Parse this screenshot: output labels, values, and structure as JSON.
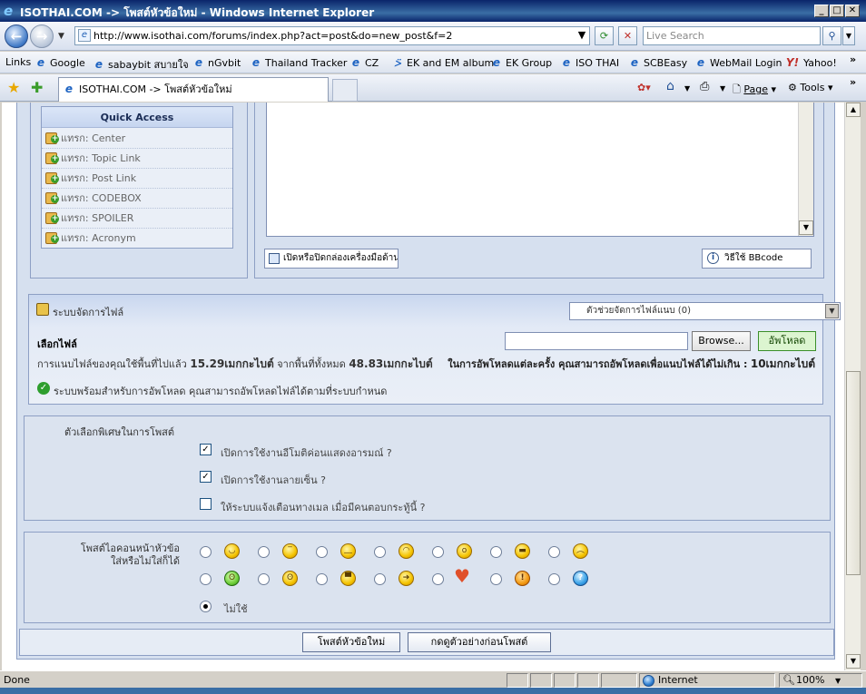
{
  "window": {
    "title": "ISOTHAI.COM -> โพสต์หัวข้อใหม่ - Windows Internet Explorer"
  },
  "address_bar": {
    "url": "http://www.isothai.com/forums/index.php?act=post&do=new_post&f=2",
    "search_placeholder": "Live Search"
  },
  "links_bar": {
    "label": "Links",
    "items": [
      "Google",
      "sabaybit สบายใจ",
      "nGvbit",
      "Thailand Tracker",
      "CZ",
      "EK and EM album",
      "EK Group",
      "ISO THAI",
      "SCBEasy",
      "WebMail Login",
      "Yahoo!"
    ]
  },
  "tab_bar": {
    "active_tab": "ISOTHAI.COM -> โพสต์หัวข้อใหม่",
    "page_menu": "Page",
    "tools_menu": "Tools"
  },
  "quick_access": {
    "title": "Quick Access",
    "items": [
      "แทรก: Center",
      "แทรก: Topic Link",
      "แทรก: Post Link",
      "แทรก: CODEBOX",
      "แทรก: SPOILER",
      "แทรก: Acronym"
    ]
  },
  "editor": {
    "toggle_toolbar_label": "เปิดหรือปิดกล่องเครื่องมือด้านข",
    "bbcode_help_label": "วิธีใช้ BBcode"
  },
  "file_manager": {
    "title": "ระบบจัดการไฟล์",
    "attach_helper_select": "ตัวช่วยจัดการไฟล์แนบ (0)",
    "choose_file_label": "เลือกไฟล์",
    "browse_label": "Browse...",
    "upload_label": "อัพโหลด",
    "usage_prefix": "การแนบไฟล์ของคุณใช้พื้นที่ไปแล้ว",
    "used_space": "15.29เมกกะไบต์",
    "usage_middle": "จากพื้นที่ทั้งหมด",
    "total_space": "48.83เมกกะไบต์",
    "limit_prefix": "ในการอัพโหลดแต่ละครั้ง คุณสามารถอัพโหลดเพื่อแนบไฟล์ได้ไม่เกิน :",
    "limit_value": "10เมกกะไบต์",
    "ready_message": "ระบบพร้อมสำหรับการอัพโหลด คุณสามารถอัพโหลดไฟล์ได้ตามที่ระบบกำหนด"
  },
  "post_options": {
    "title": "ตัวเลือกพิเศษในการโพสต์",
    "options": [
      {
        "label": "เปิดการใช้งานอีโมติค่อนแสดงอารมณ์ ?",
        "checked": true
      },
      {
        "label": "เปิดการใช้งานลายเซ็น ?",
        "checked": true
      },
      {
        "label": "ให้ระบบแจ้งเตือนทางเมล เมื่อมีคนตอบกระทู้นี้ ?",
        "checked": false
      }
    ]
  },
  "post_icons": {
    "title_line1": "โพสต์ไอคอนหน้าหัวข้อ",
    "title_line2": "ใส่หรือไม่ใส่ก็ได้",
    "none_label": "ไม่ใช้",
    "icons_row1": [
      "smile-icon",
      "neutral-icon",
      "sleepy-icon",
      "wink-icon",
      "surprised-icon",
      "grin-icon",
      "angry-icon"
    ],
    "icons_row2": [
      "sick-icon",
      "confused-icon",
      "cool-icon",
      "arrow-right-icon",
      "heart-icon",
      "warning-icon",
      "question-icon"
    ],
    "selected": "none"
  },
  "actions": {
    "submit_label": "โพสต์หัวข้อใหม่",
    "preview_label": "กดดูตัวอย่างก่อนโพสต์"
  },
  "status_bar": {
    "status": "Done",
    "zone": "Internet",
    "zoom": "100%"
  }
}
